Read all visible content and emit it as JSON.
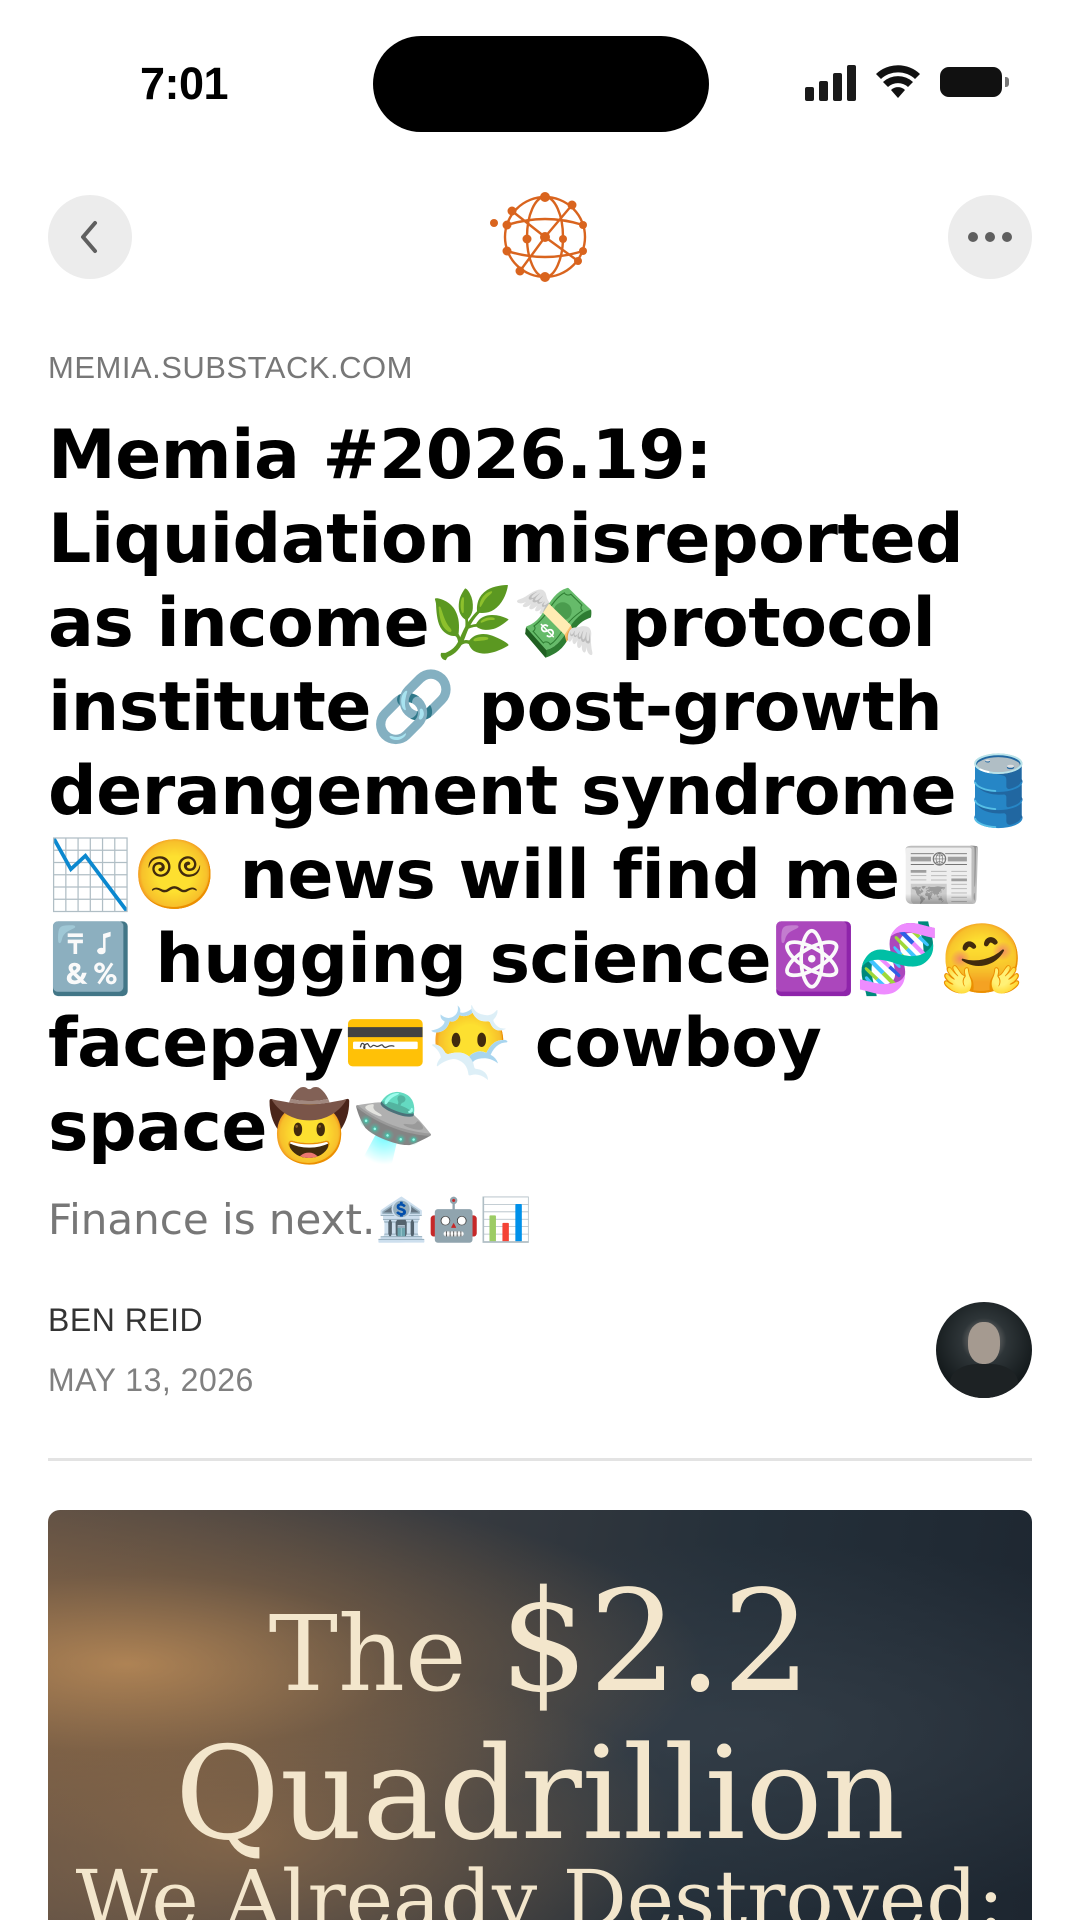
{
  "status_bar": {
    "time": "7:01"
  },
  "nav": {
    "back_icon": "chevron-left-icon",
    "more_icon": "ellipsis-icon",
    "logo": "memia-globe-logo"
  },
  "article": {
    "domain": "MEMIA.SUBSTACK.COM",
    "title": "Memia #2026.19: Liquidation misreported as income🌿💸 protocol institute🔗 post-growth derangement syndrome🛢️📉😵‍💫 news will find me📰🔣 hugging science⚛️🧬🤗 facepay💳😶‍🌫️ cowboy space🤠🛸",
    "subtitle": "Finance is next.🏦🤖📊",
    "author": "BEN REID",
    "date": "MAY 13, 2026"
  },
  "hero_image": {
    "line1_prefix": "The ",
    "line1_amount": "$2.2",
    "line2": "Quadrillion",
    "line3": "We Already Destroyed:"
  },
  "colors": {
    "accent": "#d9641e",
    "muted_text": "#777777",
    "hero_text": "#f3e6cc"
  }
}
